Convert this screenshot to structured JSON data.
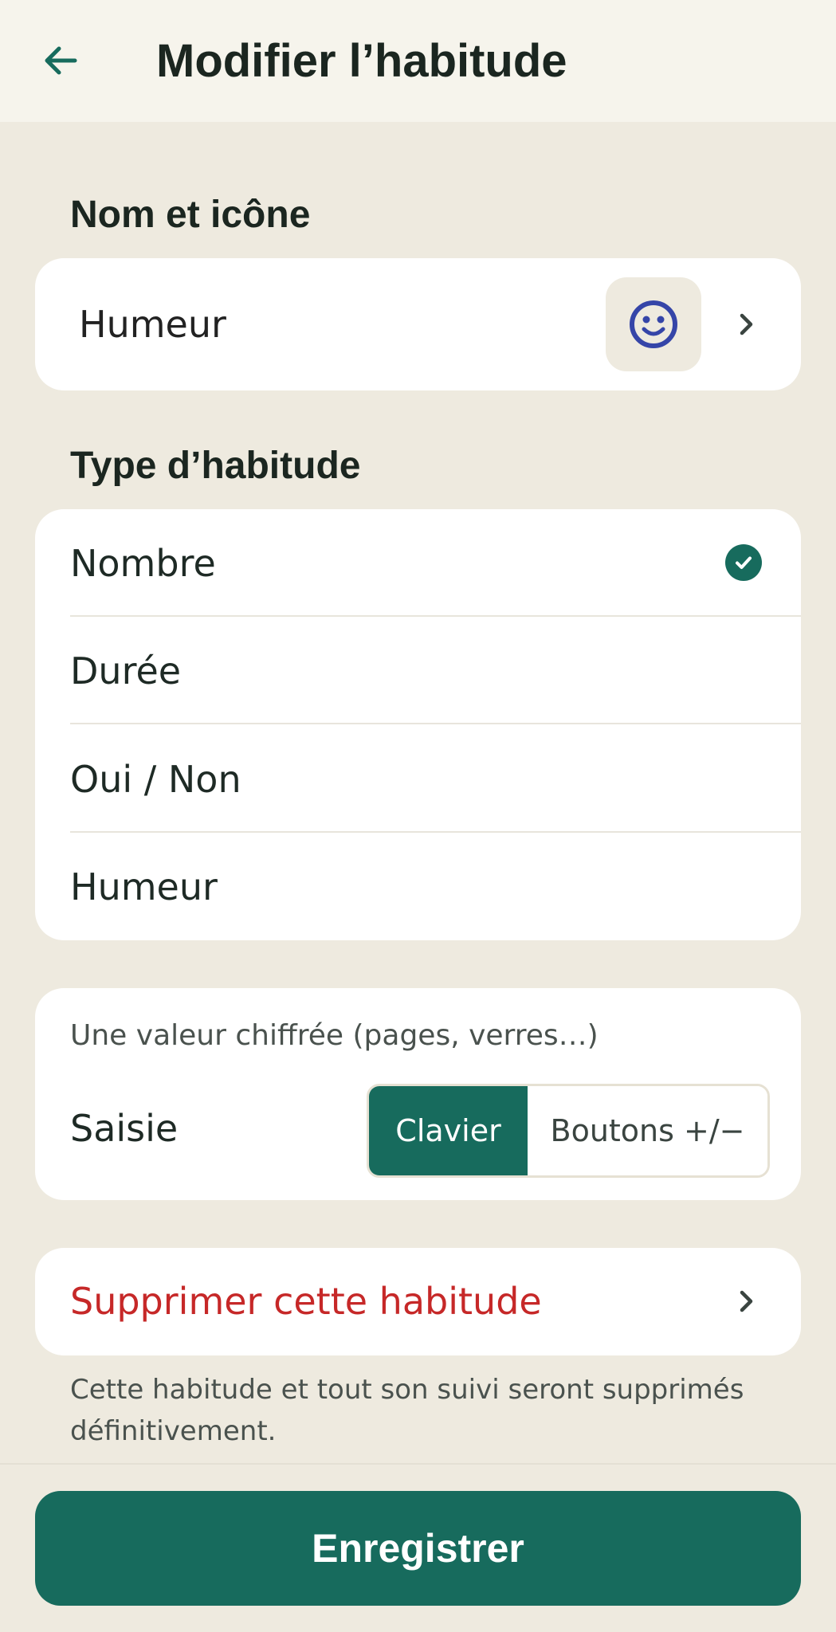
{
  "header": {
    "title": "Modifier l’habitude",
    "back_icon": "arrow-left-icon"
  },
  "name_section": {
    "title": "Nom et icône",
    "value": "Humeur",
    "icon": "smiley-face-icon",
    "chevron": "chevron-right-icon"
  },
  "type_section": {
    "title": "Type d’habitude",
    "options": [
      {
        "label": "Nombre",
        "selected": true
      },
      {
        "label": "Durée",
        "selected": false
      },
      {
        "label": "Oui / Non",
        "selected": false
      },
      {
        "label": "Humeur",
        "selected": false
      }
    ]
  },
  "input_section": {
    "description": "Une valeur chiffrée (pages, verres…)",
    "label": "Saisie",
    "options": [
      "Clavier",
      "Boutons +/−"
    ],
    "selected": "Clavier"
  },
  "delete_section": {
    "label": "Supprimer cette habitude",
    "note": "Cette habitude et tout son suivi seront supprimés définitivement."
  },
  "footer": {
    "save_label": "Enregistrer"
  },
  "colors": {
    "accent": "#176B5D",
    "danger": "#C62828",
    "background": "#EEEADF",
    "icon_blue": "#3545A8"
  }
}
